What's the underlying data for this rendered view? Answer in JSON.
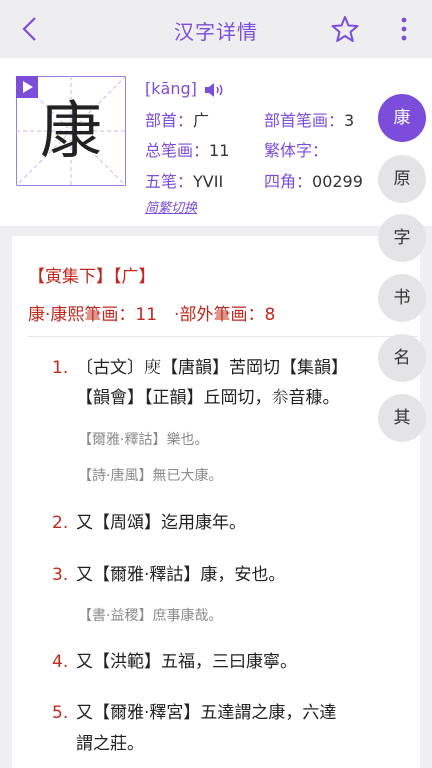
{
  "topbar": {
    "title": "汉字详情",
    "back_icon": "chevron-left-icon",
    "star_icon": "star-outline-icon",
    "more_icon": "more-vertical-icon"
  },
  "colors": {
    "accent": "#7c4ddb",
    "kangxi_red": "#c0281c"
  },
  "character": {
    "glyph": "康",
    "pinyin": "[kāng]",
    "radical_label": "部首：",
    "radical": "广",
    "radical_strokes_label": "部首笔画：",
    "radical_strokes": "3",
    "total_strokes_label": "总笔画：",
    "total_strokes": "11",
    "traditional_label": "繁体字：",
    "traditional": "",
    "wubi_label": "五笔：",
    "wubi": "YVII",
    "sijiao_label": "四角：",
    "sijiao": "00299",
    "toggle_link": "简繁切换"
  },
  "side_tabs": [
    "康",
    "原",
    "字",
    "书",
    "名",
    "其"
  ],
  "kangxi": {
    "volume": "【寅集下】【广】",
    "counts": "康·康熙筆画：11　·部外筆画：8",
    "entries": [
      {
        "num": "1.",
        "lines": [
          "〔古文〕𢊎【唐韻】苦岡切【集韻】",
          "【韻會】【正韻】丘岡切，𠫭音穅。"
        ],
        "quotes": [
          "【爾雅·釋詁】樂也。",
          "【詩·唐風】無已大康。"
        ]
      },
      {
        "num": "2.",
        "lines": [
          "又【周頌】迄用康年。"
        ],
        "quotes": []
      },
      {
        "num": "3.",
        "lines": [
          "又【爾雅·釋詁】康，安也。"
        ],
        "quotes": [
          "【書·益稷】庶事康哉。"
        ]
      },
      {
        "num": "4.",
        "lines": [
          "又【洪範】五福，三曰康寧。"
        ],
        "quotes": []
      },
      {
        "num": "5.",
        "lines": [
          "又【爾雅·釋宮】五達謂之康，六達",
          "謂之莊。"
        ],
        "quotes": []
      }
    ]
  }
}
